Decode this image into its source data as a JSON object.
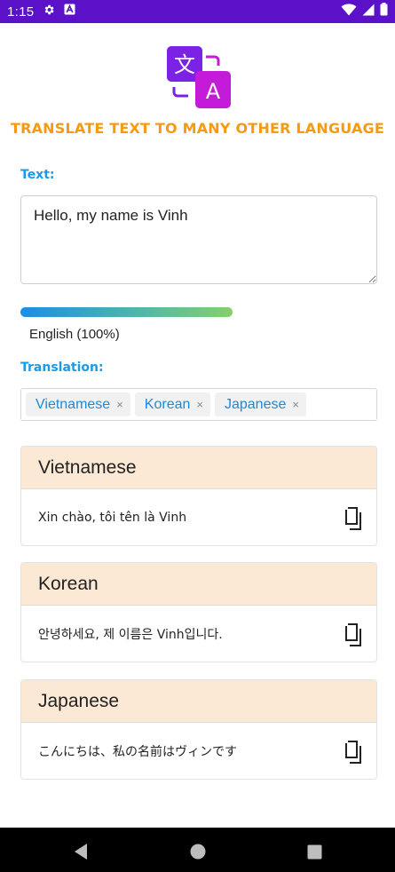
{
  "status_bar": {
    "time": "1:15",
    "icons": [
      "gear-icon",
      "a-box-icon",
      "wifi-icon",
      "signal-icon",
      "battery-icon"
    ]
  },
  "logo": {
    "glyph_back": "文",
    "glyph_front": "A",
    "colors": {
      "purple": "#7c22e4",
      "magenta": "#c41bd9"
    }
  },
  "header": {
    "title": "Translate text to many other language"
  },
  "input_section": {
    "label": "Text:",
    "text": "Hello, my name is Vinh"
  },
  "detection": {
    "label": "English (100%)",
    "confidence": 1.0
  },
  "translation_section": {
    "label": "Translation:",
    "selected_languages": [
      "Vietnamese",
      "Korean",
      "Japanese"
    ],
    "remove_glyph": "×"
  },
  "results": [
    {
      "language": "Vietnamese",
      "text": "Xin chào, tôi tên là Vinh"
    },
    {
      "language": "Korean",
      "text": "안녕하세요, 제 이름은 Vinh입니다."
    },
    {
      "language": "Japanese",
      "text": "こんにちは、私の名前はヴィンです"
    }
  ],
  "colors": {
    "status_bar": "#5a11c8",
    "title_orange": "#f79a0f",
    "label_blue": "#1a9be6",
    "card_header": "#fbe9d5"
  },
  "nav_bar": {
    "icons": [
      "back-icon",
      "home-icon",
      "recents-icon"
    ]
  }
}
